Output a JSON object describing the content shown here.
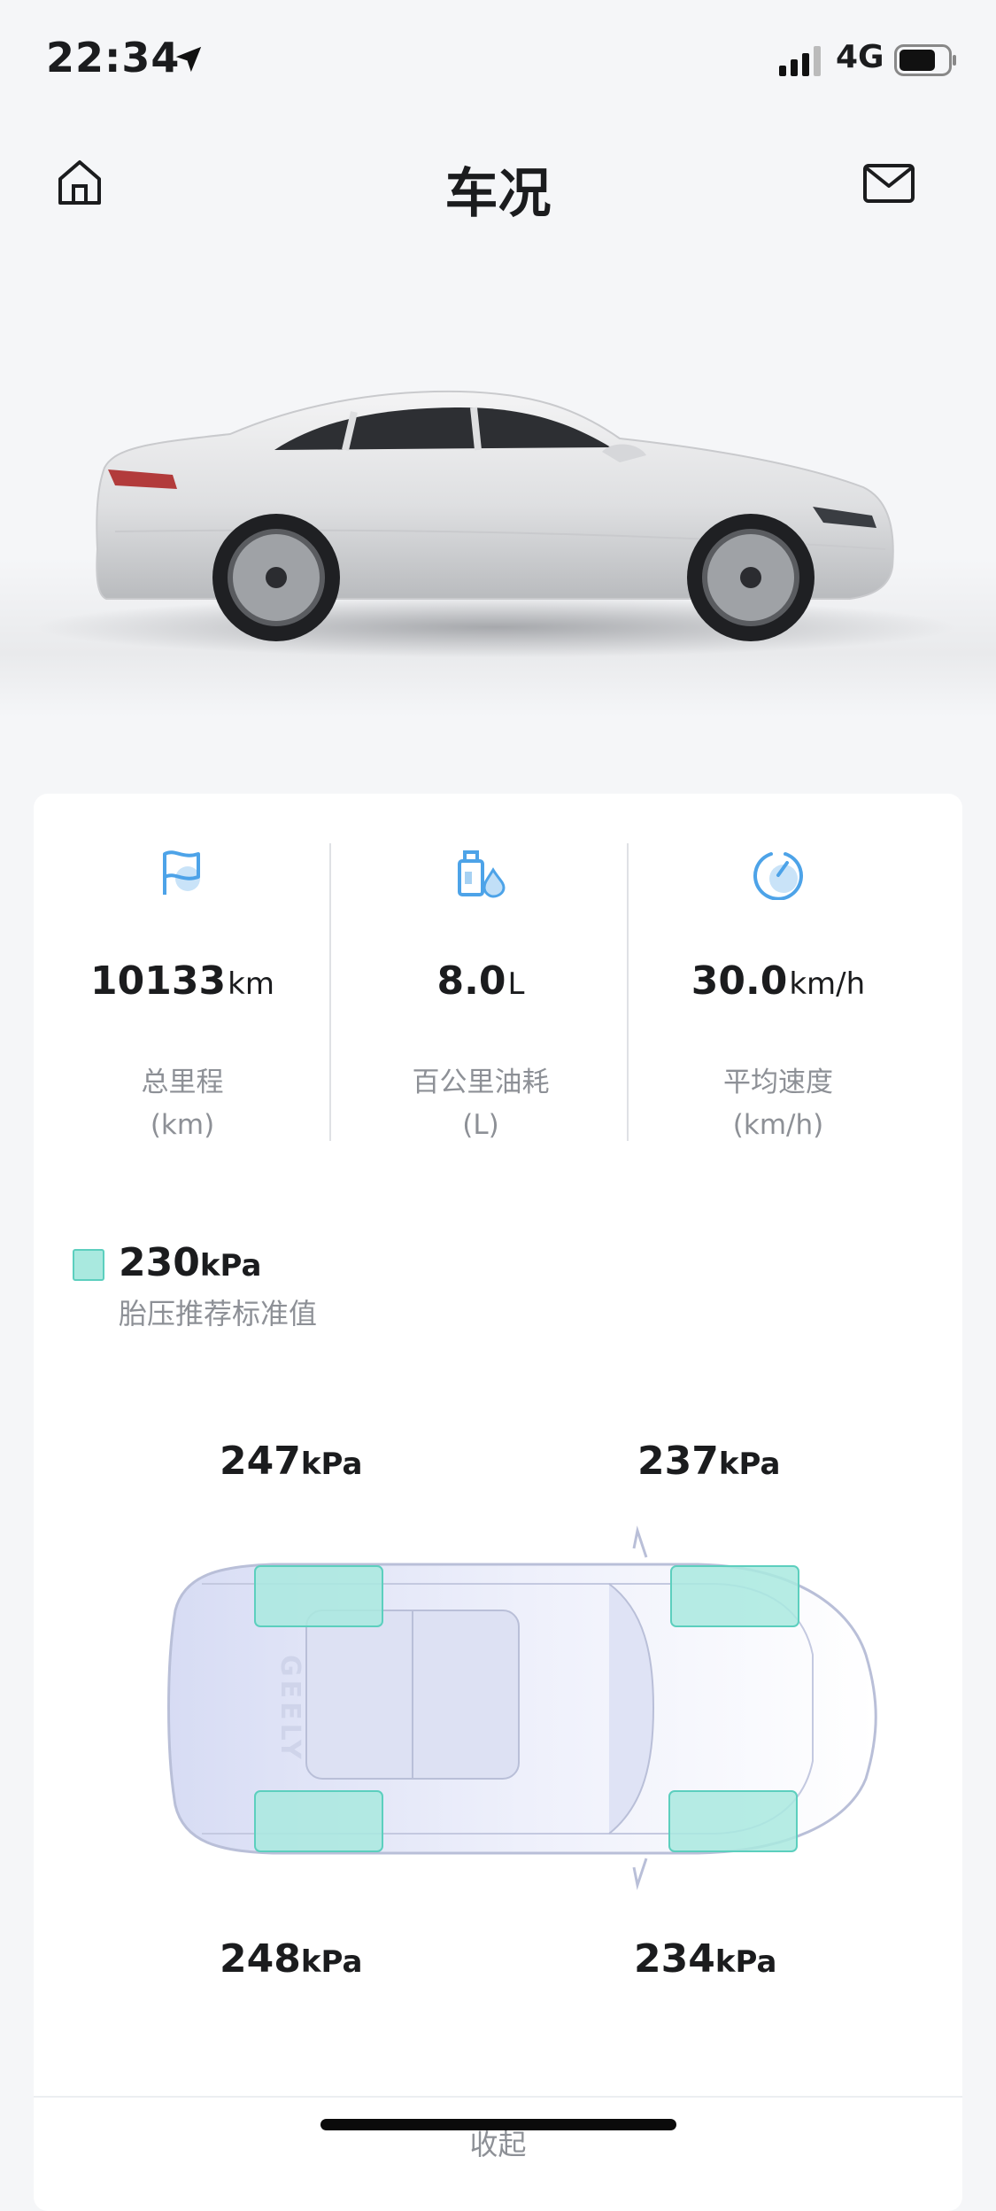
{
  "status_bar": {
    "time": "22:34",
    "network": "4G",
    "icons": [
      "location-arrow-icon",
      "signal-icon",
      "battery-icon"
    ]
  },
  "nav": {
    "title": "车况",
    "left_icon": "home-icon",
    "right_icon": "mail-icon"
  },
  "stats": [
    {
      "icon": "flag-icon",
      "value": "10133",
      "unit": "km",
      "label": "总里程",
      "sublabel": "(km)"
    },
    {
      "icon": "fuel-icon",
      "value": "8.0",
      "unit": "L",
      "label": "百公里油耗",
      "sublabel": "(L)"
    },
    {
      "icon": "speedometer-icon",
      "value": "30.0",
      "unit": "km/h",
      "label": "平均速度",
      "sublabel": "(km/h)"
    }
  ],
  "tire": {
    "recommended": {
      "value": "230",
      "unit": "kPa",
      "label": "胎压推荐标准值"
    },
    "front_left": {
      "value": "247",
      "unit": "kPa"
    },
    "front_right": {
      "value": "237",
      "unit": "kPa"
    },
    "rear_left": {
      "value": "248",
      "unit": "kPa"
    },
    "rear_right": {
      "value": "234",
      "unit": "kPa"
    },
    "car_brand": "GEELY"
  },
  "collapse_label": "收起",
  "colors": {
    "accent_blue": "#4da3e8",
    "tire_fill": "#a9e9df",
    "tire_border": "#5ccfbe"
  }
}
